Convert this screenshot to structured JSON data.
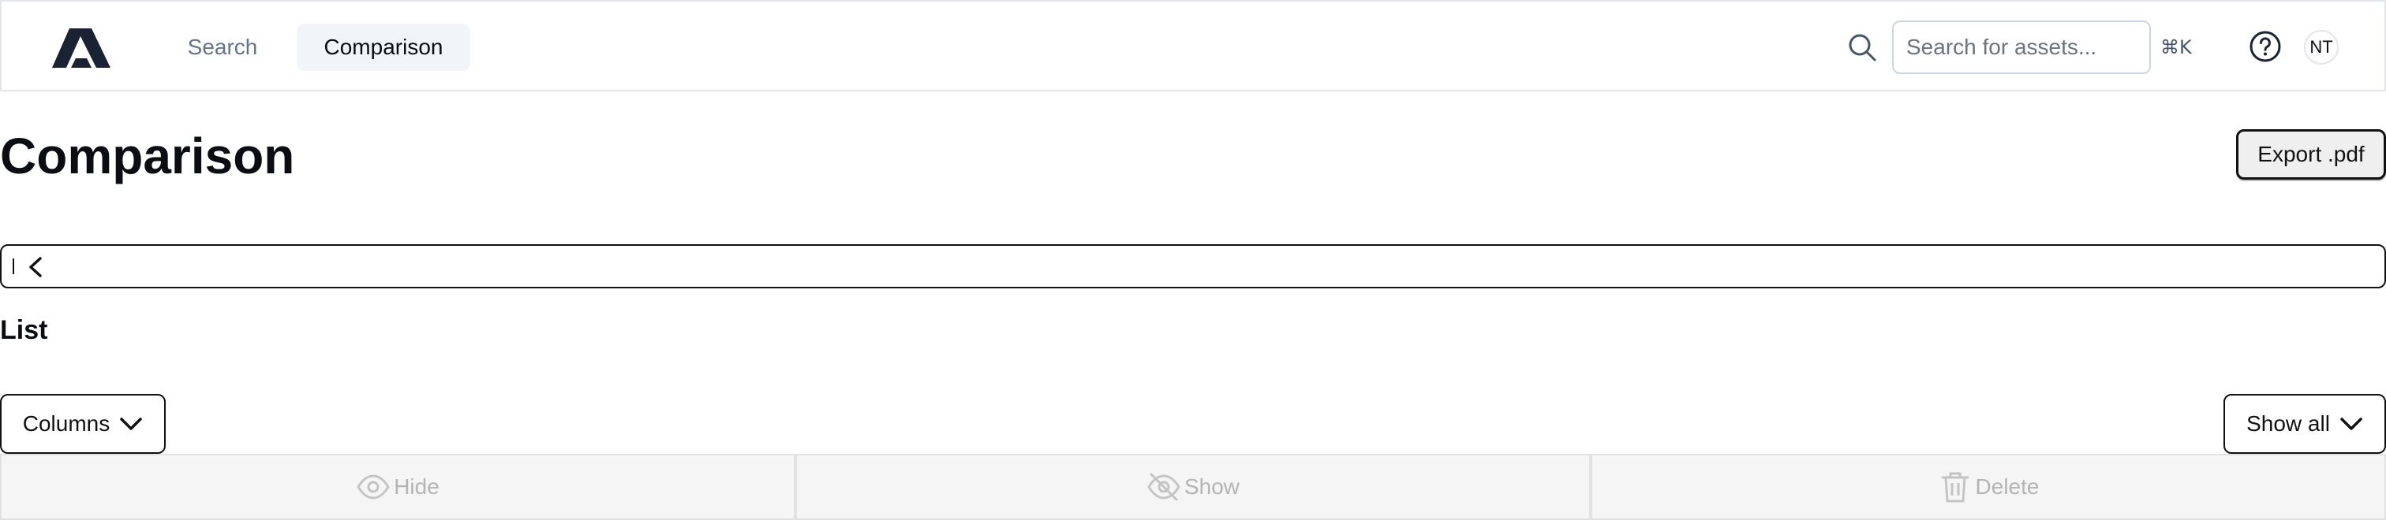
{
  "nav": {
    "logo_icon": "brand-logo-icon",
    "links": [
      {
        "label": "Search",
        "active": false
      },
      {
        "label": "Comparison",
        "active": true
      }
    ],
    "search": {
      "placeholder": "Search for assets...",
      "value": "",
      "shortcut": "⌘K"
    },
    "help_icon": "help-circle-icon",
    "avatar_initials": "NT"
  },
  "header": {
    "title": "Comparison",
    "export_label": "Export .pdf"
  },
  "panel": {
    "toggle_icon": "chevron-left-icon"
  },
  "list": {
    "title": "List",
    "columns_label": "Columns",
    "show_all_label": "Show all"
  },
  "actions": {
    "hide_label": "Hide",
    "show_label": "Show",
    "delete_label": "Delete",
    "disabled": true
  },
  "colors": {
    "brand": "#1a2233",
    "active_tab_bg": "#f1f5f9",
    "muted_text": "#64748b",
    "disabled_text": "#b4b4b4"
  }
}
